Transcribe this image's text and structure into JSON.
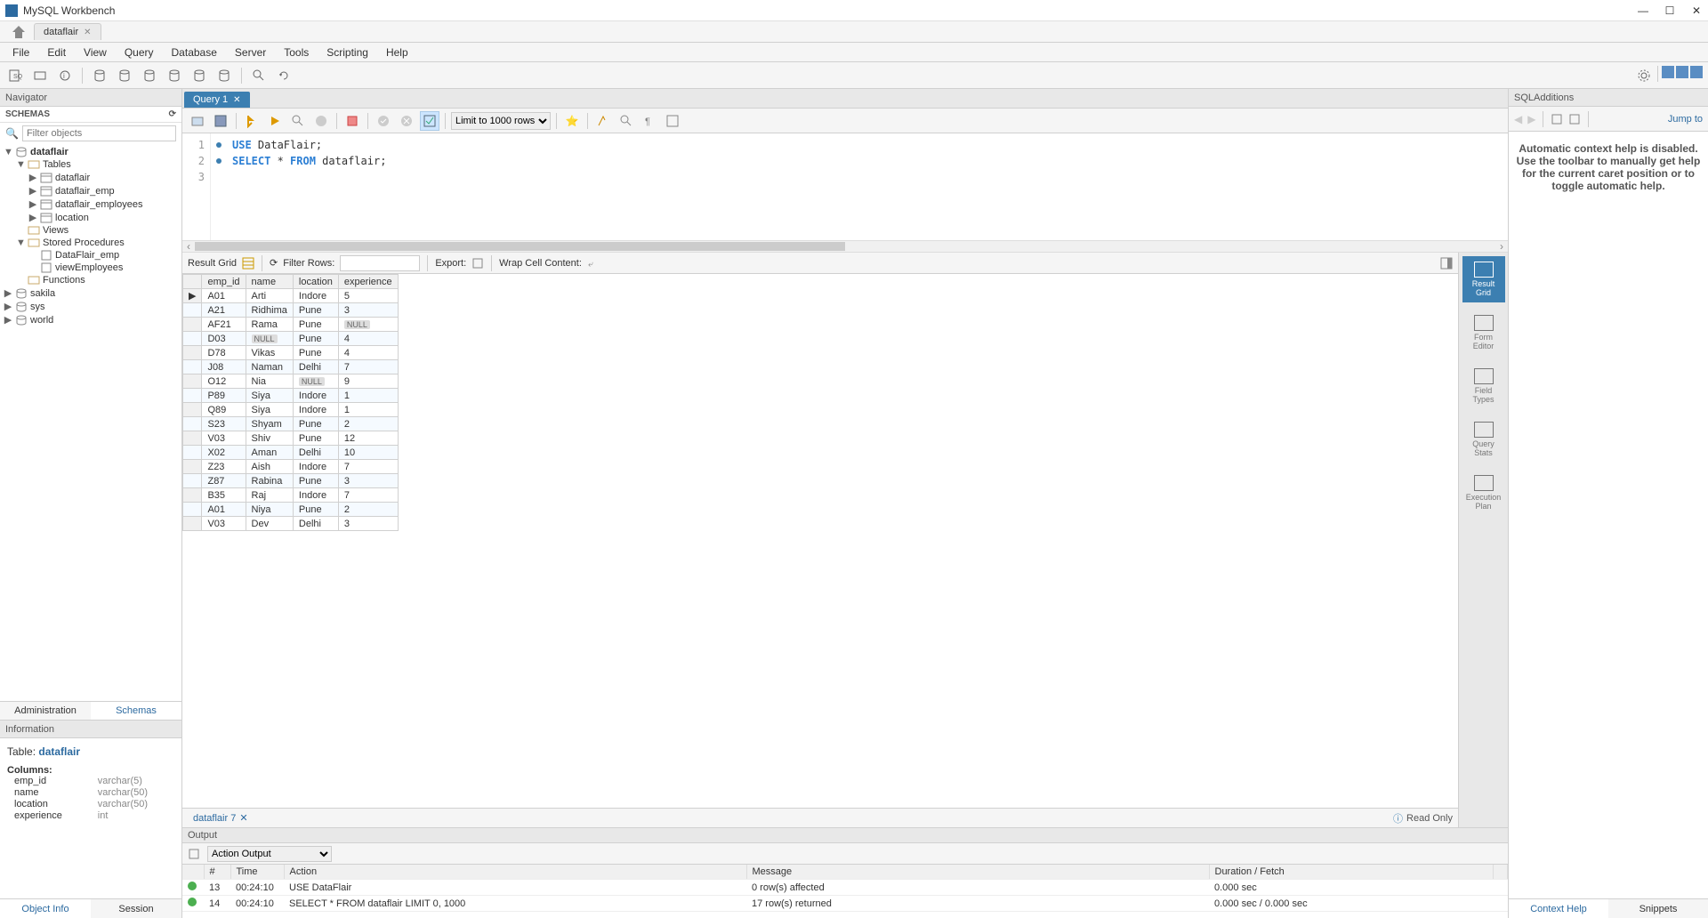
{
  "app": {
    "title": "MySQL Workbench"
  },
  "connection_tab": "dataflair",
  "menu": [
    "File",
    "Edit",
    "View",
    "Query",
    "Database",
    "Server",
    "Tools",
    "Scripting",
    "Help"
  ],
  "navigator": {
    "title": "Navigator",
    "schemas_label": "SCHEMAS",
    "filter_placeholder": "Filter objects",
    "tabs": {
      "admin": "Administration",
      "schemas": "Schemas"
    },
    "info_header": "Information",
    "bottom_tabs": {
      "object_info": "Object Info",
      "session": "Session"
    }
  },
  "tree": {
    "dataflair": "dataflair",
    "tables": "Tables",
    "tbl_dataflair": "dataflair",
    "tbl_emp": "dataflair_emp",
    "tbl_employees": "dataflair_employees",
    "tbl_location": "location",
    "views": "Views",
    "stored_procs": "Stored Procedures",
    "sp_emp": "DataFlair_emp",
    "sp_view": "viewEmployees",
    "functions": "Functions",
    "sakila": "sakila",
    "sys": "sys",
    "world": "world"
  },
  "info": {
    "table_label": "Table: ",
    "table_name": "dataflair",
    "columns_label": "Columns:",
    "cols": [
      {
        "name": "emp_id",
        "type": "varchar(5)"
      },
      {
        "name": "name",
        "type": "varchar(50)"
      },
      {
        "name": "location",
        "type": "varchar(50)"
      },
      {
        "name": "experience",
        "type": "int"
      }
    ]
  },
  "query": {
    "tab": "Query 1",
    "limit": "Limit to 1000 rows",
    "lines": [
      "1",
      "2",
      "3"
    ],
    "code1_kw1": "USE",
    "code1_rest": " DataFlair;",
    "code2_kw1": "SELECT",
    "code2_mid": " * ",
    "code2_kw2": "FROM",
    "code2_rest": " dataflair;"
  },
  "result": {
    "grid_label": "Result Grid",
    "filter_label": "Filter Rows:",
    "export_label": "Export:",
    "wrap_label": "Wrap Cell Content:",
    "readonly": "Read Only",
    "tab": "dataflair 7",
    "columns": [
      "emp_id",
      "name",
      "location",
      "experience"
    ],
    "rows": [
      [
        "A01",
        "Arti",
        "Indore",
        "5"
      ],
      [
        "A21",
        "Ridhima",
        "Pune",
        "3"
      ],
      [
        "AF21",
        "Rama",
        "Pune",
        null
      ],
      [
        "D03",
        null,
        "Pune",
        "4"
      ],
      [
        "D78",
        "Vikas",
        "Pune",
        "4"
      ],
      [
        "J08",
        "Naman",
        "Delhi",
        "7"
      ],
      [
        "O12",
        "Nia",
        null,
        "9"
      ],
      [
        "P89",
        "Siya",
        "Indore",
        "1"
      ],
      [
        "Q89",
        "Siya",
        "Indore",
        "1"
      ],
      [
        "S23",
        "Shyam",
        "Pune",
        "2"
      ],
      [
        "V03",
        "Shiv",
        "Pune",
        "12"
      ],
      [
        "X02",
        "Aman",
        "Delhi",
        "10"
      ],
      [
        "Z23",
        "Aish",
        "Indore",
        "7"
      ],
      [
        "Z87",
        "Rabina",
        "Pune",
        "3"
      ],
      [
        "B35",
        "Raj",
        "Indore",
        "7"
      ],
      [
        "A01",
        "Niya",
        "Pune",
        "2"
      ],
      [
        "V03",
        "Dev",
        "Delhi",
        "3"
      ]
    ],
    "side": {
      "result_grid": "Result Grid",
      "form_editor": "Form Editor",
      "field_types": "Field Types",
      "query_stats": "Query Stats",
      "exec_plan": "Execution Plan"
    }
  },
  "output": {
    "header": "Output",
    "dropdown": "Action Output",
    "cols": {
      "num": "#",
      "time": "Time",
      "action": "Action",
      "message": "Message",
      "duration": "Duration / Fetch"
    },
    "rows": [
      {
        "num": "13",
        "time": "00:24:10",
        "action": "USE DataFlair",
        "message": "0 row(s) affected",
        "duration": "0.000 sec"
      },
      {
        "num": "14",
        "time": "00:24:10",
        "action": "SELECT * FROM dataflair LIMIT 0, 1000",
        "message": "17 row(s) returned",
        "duration": "0.000 sec / 0.000 sec"
      }
    ]
  },
  "sqladditions": {
    "title": "SQLAdditions",
    "jump": "Jump to",
    "help": "Automatic context help is disabled. Use the toolbar to manually get help for the current caret position or to toggle automatic help.",
    "tabs": {
      "context": "Context Help",
      "snippets": "Snippets"
    }
  }
}
